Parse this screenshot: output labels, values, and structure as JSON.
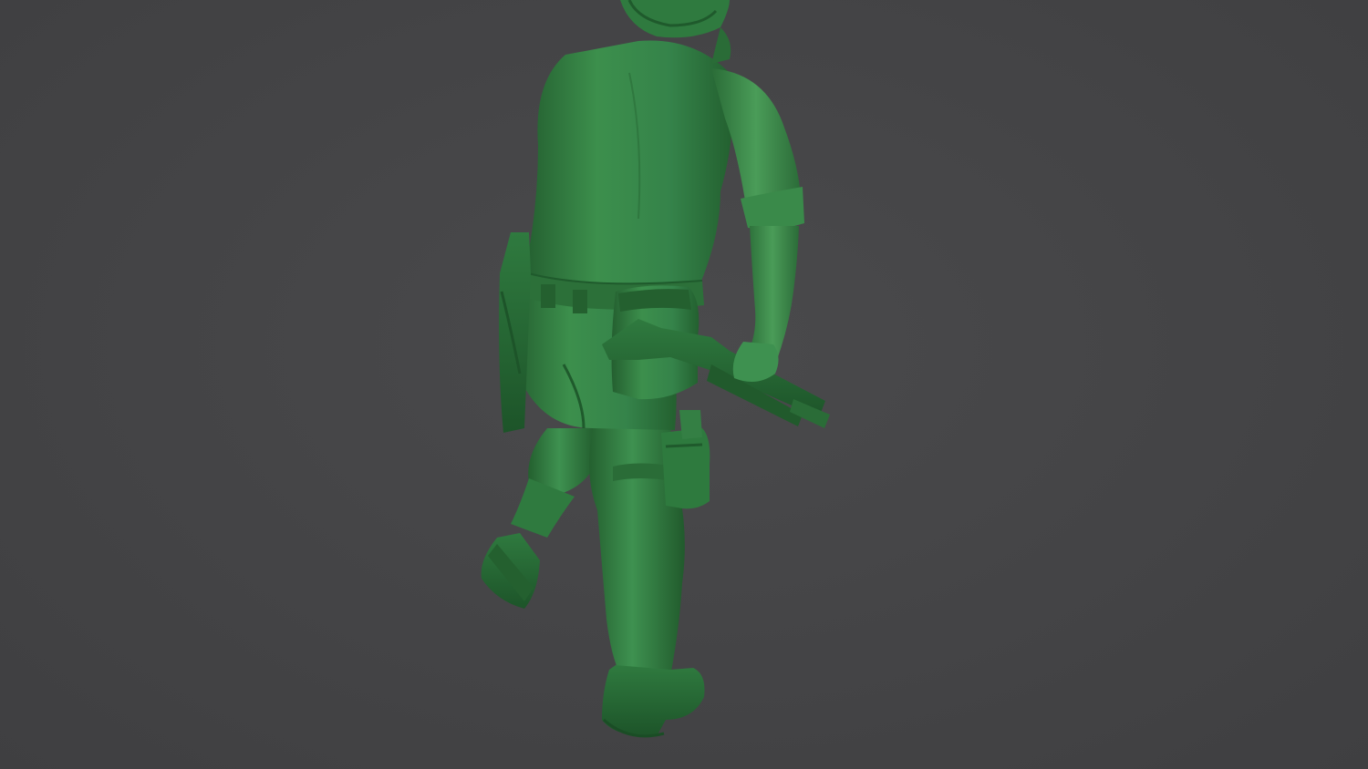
{
  "scene": {
    "background_color": "#444446",
    "subject": "green-plastic-soldier-figurine",
    "figure_colors": {
      "base": "#2f7a3f",
      "highlight": "#4fa55e",
      "mid": "#3a8a4a",
      "shadow": "#1f5a2c",
      "deep_shadow": "#174522"
    }
  }
}
